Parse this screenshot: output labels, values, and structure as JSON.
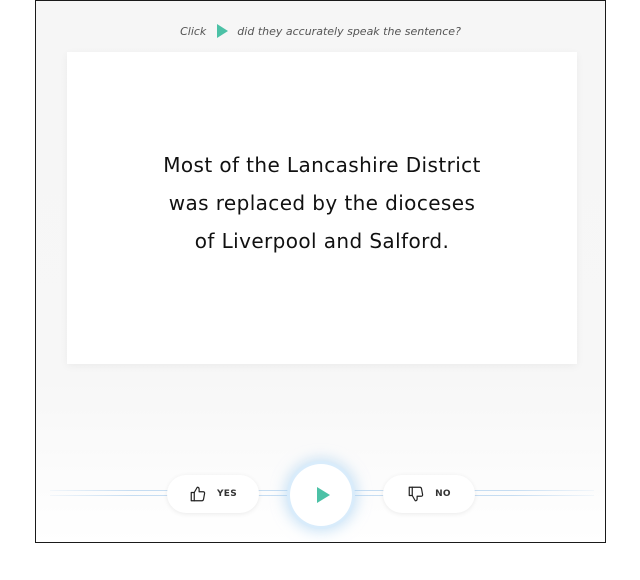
{
  "instruction": {
    "prefix": "Click",
    "suffix": "did they accurately speak the sentence?",
    "play_icon": "play-icon"
  },
  "card": {
    "sentence_lines": [
      "Most of the Lancashire District",
      "was replaced by the dioceses",
      "of Liverpool and Salford."
    ]
  },
  "controls": {
    "yes_label": "YES",
    "yes_icon": "thumbs-up-icon",
    "no_label": "NO",
    "no_icon": "thumbs-down-icon",
    "play_icon": "play-icon"
  },
  "colors": {
    "accent": "#4cc1a6",
    "play_glow": "#d9ecfb",
    "track": "#c6ddf2"
  }
}
